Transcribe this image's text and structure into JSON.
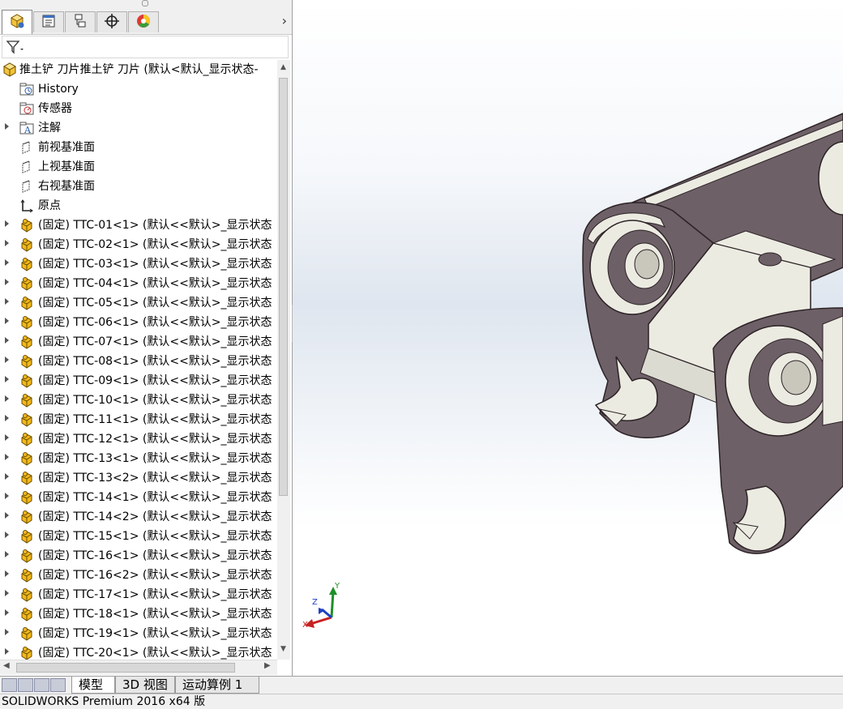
{
  "panel_tabs": [
    {
      "name": "feature-manager-icon",
      "active": true
    },
    {
      "name": "property-manager-icon",
      "active": false
    },
    {
      "name": "configuration-manager-icon",
      "active": false
    },
    {
      "name": "dimxpert-manager-icon",
      "active": false
    },
    {
      "name": "display-manager-icon",
      "active": false
    }
  ],
  "tree": {
    "root_label": "推土铲 刀片推土铲 刀片  (默认<默认_显示状态-",
    "items": [
      {
        "label": "History",
        "icon": "history-folder-icon",
        "expandable": false
      },
      {
        "label": "传感器",
        "icon": "sensor-icon",
        "expandable": false
      },
      {
        "label": "注解",
        "icon": "annotation-icon",
        "expandable": true
      },
      {
        "label": "前视基准面",
        "icon": "plane-icon",
        "expandable": false
      },
      {
        "label": "上视基准面",
        "icon": "plane-icon",
        "expandable": false
      },
      {
        "label": "右视基准面",
        "icon": "plane-icon",
        "expandable": false
      },
      {
        "label": "原点",
        "icon": "origin-icon",
        "expandable": false
      },
      {
        "label": "(固定) TTC-01<1> (默认<<默认>_显示状态",
        "icon": "part-icon",
        "expandable": true
      },
      {
        "label": "(固定) TTC-02<1> (默认<<默认>_显示状态",
        "icon": "part-icon",
        "expandable": true
      },
      {
        "label": "(固定) TTC-03<1> (默认<<默认>_显示状态",
        "icon": "part-icon",
        "expandable": true
      },
      {
        "label": "(固定) TTC-04<1> (默认<<默认>_显示状态",
        "icon": "part-icon",
        "expandable": true
      },
      {
        "label": "(固定) TTC-05<1> (默认<<默认>_显示状态",
        "icon": "part-icon",
        "expandable": true
      },
      {
        "label": "(固定) TTC-06<1> (默认<<默认>_显示状态",
        "icon": "part-icon",
        "expandable": true
      },
      {
        "label": "(固定) TTC-07<1> (默认<<默认>_显示状态",
        "icon": "part-icon",
        "expandable": true
      },
      {
        "label": "(固定) TTC-08<1> (默认<<默认>_显示状态",
        "icon": "part-icon",
        "expandable": true
      },
      {
        "label": "(固定) TTC-09<1> (默认<<默认>_显示状态",
        "icon": "part-icon",
        "expandable": true
      },
      {
        "label": "(固定) TTC-10<1> (默认<<默认>_显示状态",
        "icon": "part-icon",
        "expandable": true
      },
      {
        "label": "(固定) TTC-11<1> (默认<<默认>_显示状态",
        "icon": "part-icon",
        "expandable": true
      },
      {
        "label": "(固定) TTC-12<1> (默认<<默认>_显示状态",
        "icon": "part-icon",
        "expandable": true
      },
      {
        "label": "(固定) TTC-13<1> (默认<<默认>_显示状态",
        "icon": "part-icon",
        "expandable": true
      },
      {
        "label": "(固定) TTC-13<2> (默认<<默认>_显示状态",
        "icon": "part-icon",
        "expandable": true
      },
      {
        "label": "(固定) TTC-14<1> (默认<<默认>_显示状态",
        "icon": "part-icon",
        "expandable": true
      },
      {
        "label": "(固定) TTC-14<2> (默认<<默认>_显示状态",
        "icon": "part-icon",
        "expandable": true
      },
      {
        "label": "(固定) TTC-15<1> (默认<<默认>_显示状态",
        "icon": "part-icon",
        "expandable": true
      },
      {
        "label": "(固定) TTC-16<1> (默认<<默认>_显示状态",
        "icon": "part-icon",
        "expandable": true
      },
      {
        "label": "(固定) TTC-16<2> (默认<<默认>_显示状态",
        "icon": "part-icon",
        "expandable": true
      },
      {
        "label": "(固定) TTC-17<1> (默认<<默认>_显示状态",
        "icon": "part-icon",
        "expandable": true
      },
      {
        "label": "(固定) TTC-18<1> (默认<<默认>_显示状态",
        "icon": "part-icon",
        "expandable": true
      },
      {
        "label": "(固定) TTC-19<1> (默认<<默认>_显示状态",
        "icon": "part-icon",
        "expandable": true
      },
      {
        "label": "(固定) TTC-20<1> (默认<<默认>_显示状态",
        "icon": "part-icon",
        "expandable": true
      }
    ]
  },
  "triad": {
    "x": "X",
    "y": "Y",
    "z": "Z"
  },
  "bottom_tabs": [
    "模型",
    "3D 视图",
    "运动算例 1"
  ],
  "status": "SOLIDWORKS Premium 2016 x64 版",
  "colors": {
    "part_face": "#6e6067",
    "part_edge": "#ecebe2",
    "part_icon": "#f2b81b",
    "accent": "#2b5fae"
  }
}
